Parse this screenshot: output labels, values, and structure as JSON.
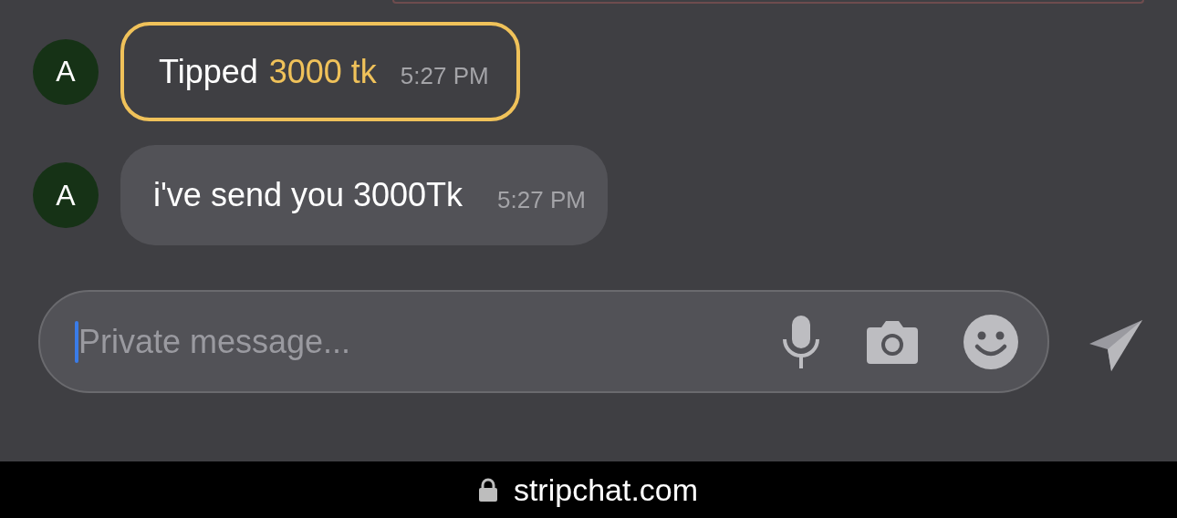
{
  "messages": [
    {
      "kind": "tip",
      "avatar": "A",
      "label": "Tipped",
      "amount": "3000 tk",
      "time": "5:27 PM"
    },
    {
      "kind": "text",
      "avatar": "A",
      "text": "i've send you 3000Tk",
      "time": "5:27 PM"
    }
  ],
  "composer": {
    "placeholder": "Private message..."
  },
  "address_bar": {
    "url": "stripchat.com"
  }
}
